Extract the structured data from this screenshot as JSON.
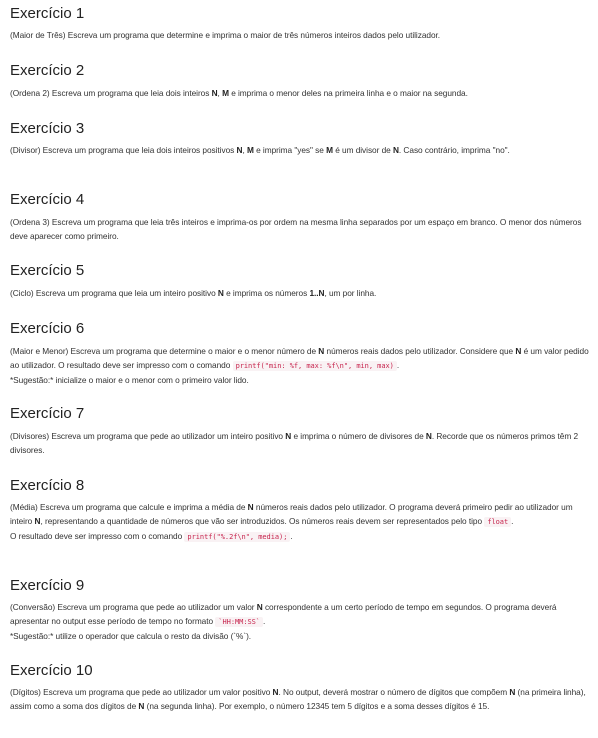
{
  "exercises": [
    {
      "title": "Exercício 1",
      "paragraphs": [
        [
          {
            "t": "(Maior de Três) Escreva um programa que determine e imprima o maior de três números inteiros dados pelo utilizador."
          }
        ]
      ]
    },
    {
      "title": "Exercício 2",
      "paragraphs": [
        [
          {
            "t": "(Ordena 2) Escreva um programa que leia dois inteiros "
          },
          {
            "t": "N",
            "b": true
          },
          {
            "t": ", "
          },
          {
            "t": "M",
            "b": true
          },
          {
            "t": " e imprima o menor deles na primeira linha e o maior na segunda."
          }
        ]
      ]
    },
    {
      "title": "Exercício 3",
      "paragraphs": [
        [
          {
            "t": "(Divisor) Escreva um programa que leia dois inteiros positivos "
          },
          {
            "t": "N",
            "b": true
          },
          {
            "t": ", "
          },
          {
            "t": "M",
            "b": true
          },
          {
            "t": " e imprima \"yes\" se "
          },
          {
            "t": "M",
            "b": true
          },
          {
            "t": " é um divisor de "
          },
          {
            "t": "N",
            "b": true
          },
          {
            "t": ". Caso contrário, imprima \"no\"."
          }
        ]
      ]
    },
    {
      "title": "Exercício 4",
      "paragraphs": [
        [
          {
            "t": "(Ordena 3) Escreva um programa que leia três inteiros e imprima-os por ordem na mesma linha separados por um espaço em branco. O menor dos números deve aparecer como primeiro."
          }
        ]
      ]
    },
    {
      "title": "Exercício 5",
      "paragraphs": [
        [
          {
            "t": "(Ciclo) Escreva um programa que leia um inteiro positivo "
          },
          {
            "t": "N",
            "b": true
          },
          {
            "t": " e imprima os números "
          },
          {
            "t": "1..N",
            "b": true
          },
          {
            "t": ", um por linha."
          }
        ]
      ]
    },
    {
      "title": "Exercício 6",
      "paragraphs": [
        [
          {
            "t": "(Maior e Menor) Escreva um programa que determine o maior e o menor número de "
          },
          {
            "t": "N",
            "b": true
          },
          {
            "t": " números reais dados pelo utilizador. Considere que "
          },
          {
            "t": "N",
            "b": true
          },
          {
            "t": " é um valor pedido ao utilizador. O resultado deve ser impresso com o comando "
          },
          {
            "t": "printf(\"min: %f, max: %f\\n\", min, max)",
            "c": true
          },
          {
            "t": "."
          }
        ],
        [
          {
            "t": "*Sugestão:* inicialize o maior e o menor com o primeiro valor lido."
          }
        ]
      ]
    },
    {
      "title": "Exercício 7",
      "paragraphs": [
        [
          {
            "t": "(Divisores) Escreva um programa que pede ao utilizador um inteiro positivo "
          },
          {
            "t": "N",
            "b": true
          },
          {
            "t": " e imprima o número de divisores de "
          },
          {
            "t": "N",
            "b": true
          },
          {
            "t": ". Recorde que os números primos têm 2 divisores."
          }
        ]
      ]
    },
    {
      "title": "Exercício 8",
      "paragraphs": [
        [
          {
            "t": "(Média) Escreva um programa que calcule e imprima a média de "
          },
          {
            "t": "N",
            "b": true
          },
          {
            "t": " números reais dados pelo utilizador. O programa deverá primeiro pedir ao utilizador um inteiro "
          },
          {
            "t": "N",
            "b": true
          },
          {
            "t": ", representando a quantidade de números que vão ser introduzidos. Os números reais devem ser representados pelo tipo "
          },
          {
            "t": "float",
            "c": true
          },
          {
            "t": "."
          }
        ],
        [
          {
            "t": "O resultado deve ser impresso com o comando "
          },
          {
            "t": "printf(\"%.2f\\n\", media);",
            "c": true
          },
          {
            "t": "."
          }
        ]
      ]
    },
    {
      "title": "Exercício 9",
      "paragraphs": [
        [
          {
            "t": "(Conversão) Escreva um programa que pede ao utilizador um valor "
          },
          {
            "t": "N",
            "b": true
          },
          {
            "t": " correspondente a um certo período de tempo em segundos. O programa deverá apresentar no output esse período de tempo no formato "
          },
          {
            "t": "`HH:MM:SS`",
            "c": true
          },
          {
            "t": "."
          }
        ],
        [
          {
            "t": "*Sugestão:* utilize o operador que calcula o resto da divisão (`%`)."
          }
        ]
      ]
    },
    {
      "title": "Exercício 10",
      "paragraphs": [
        [
          {
            "t": "(Dígitos) Escreva um programa que pede ao utilizador um valor positivo "
          },
          {
            "t": "N",
            "b": true
          },
          {
            "t": ". No output, deverá mostrar o número de dígitos que compõem "
          },
          {
            "t": "N",
            "b": true
          },
          {
            "t": " (na primeira linha), assim como a soma dos dígitos de "
          },
          {
            "t": "N",
            "b": true
          },
          {
            "t": " (na segunda linha). Por exemplo, o número 12345 tem 5 dígitos e a soma desses dígitos é 15."
          }
        ]
      ]
    }
  ]
}
